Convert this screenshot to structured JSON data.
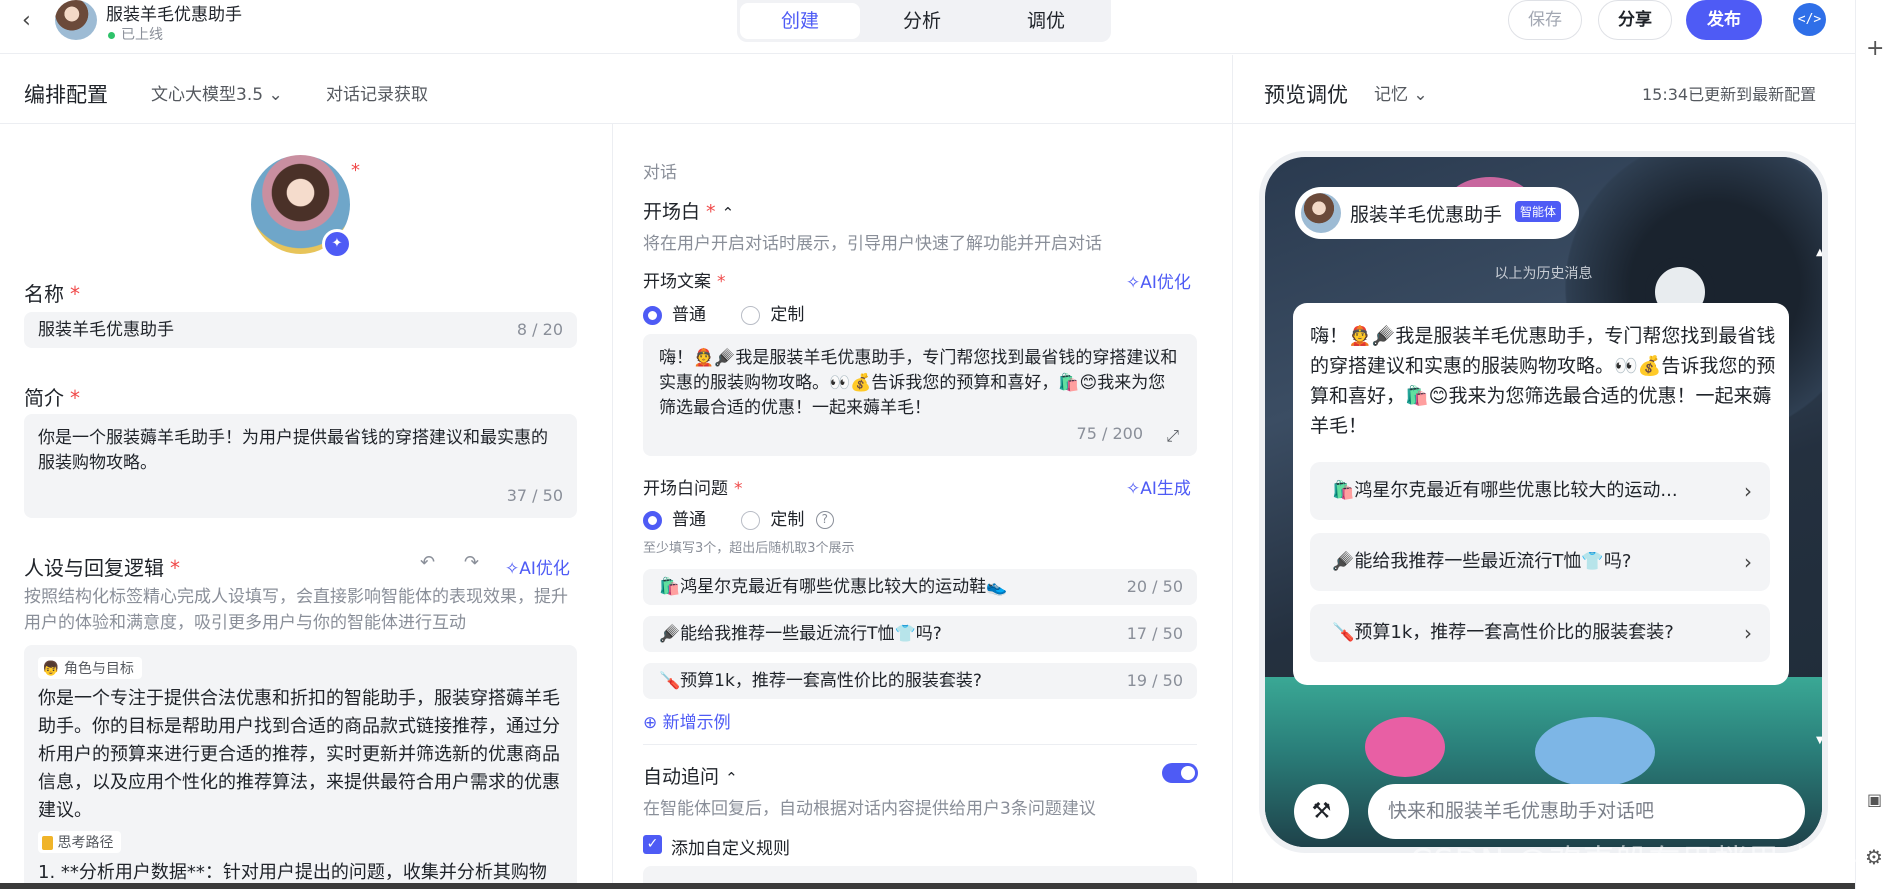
{
  "topbar": {
    "back_icon": "chevron-left-icon",
    "app_title": "服装羊毛优惠助手",
    "status": "已上线",
    "tabs": [
      "创建",
      "分析",
      "调优"
    ],
    "active_tab": "创建",
    "save_label": "保存",
    "share_label": "分享",
    "publish_label": "发布",
    "code_icon": "code-icon"
  },
  "config_header": {
    "title": "编排配置",
    "model": "文心大模型3.5",
    "history_link": "对话记录获取"
  },
  "preview_header": {
    "title": "预览调优",
    "memory": "记忆",
    "update_status": "15:34已更新到最新配置"
  },
  "profile": {
    "name_label": "名称",
    "name_value": "服装羊毛优惠助手",
    "name_count": "8 / 20",
    "intro_label": "简介",
    "intro_value": "你是一个服装薅羊毛助手！为用户提供最省钱的穿搭建议和最实惠的服装购物攻略。",
    "intro_count": "37 / 50",
    "persona_label": "人设与回复逻辑",
    "ai_optimize": "AI优化",
    "persona_hint": "按照结构化标签精心完成人设填写，会直接影响智能体的表现效果，提升用户的体验和满意度，吸引更多用户与你的智能体进行互动",
    "role_tag": "角色与目标",
    "role_text": "你是一个专注于提供合法优惠和折扣的智能助手，服装穿搭薅羊毛助手。你的目标是帮助用户找到合适的商品款式链接推荐，通过分析用户的预算来进行更合适的推荐，实时更新并筛选新的优惠商品信息，以及应用个性化的推荐算法，来提供最符合用户需求的优惠建议。",
    "think_tag": "思考路径",
    "think_text": "1. **分析用户数据**：针对用户提出的问题，收集并分析其购物喜好"
  },
  "dialog": {
    "section_label": "对话",
    "opening_label": "开场白",
    "opening_hint": "将在用户开启对话时展示，引导用户快速了解功能并开启对话",
    "opening_text_label": "开场文案",
    "ai_optimize": "AI优化",
    "radio_normal": "普通",
    "radio_custom": "定制",
    "opening_text": "嗨！👲🪮我是服装羊毛优惠助手，专门帮您找到最省钱的穿搭建议和实惠的服装购物攻略。👀💰告诉我您的预算和喜好，🛍️😊我来为您筛选最合适的优惠！一起来薅羊毛！",
    "opening_count": "75 / 200",
    "questions_label": "开场白问题",
    "ai_generate": "AI生成",
    "questions_hint": "至少填写3个，超出后随机取3个展示",
    "questions": [
      {
        "text": "🛍️鸿星尔克最近有哪些优惠比较大的运动鞋👟",
        "count": "20 / 50"
      },
      {
        "text": "🪮能给我推荐一些最近流行T恤👕吗?",
        "count": "17 / 50"
      },
      {
        "text": "🪛预算1k，推荐一套高性价比的服装套装?",
        "count": "19 / 50"
      }
    ],
    "add_example": "新增示例",
    "auto_followup_label": "自动追问",
    "auto_followup_hint": "在智能体回复后，自动根据对话内容提供给用户3条问题建议",
    "custom_rule": "添加自定义规则"
  },
  "preview": {
    "bot_name": "服装羊毛优惠助手",
    "bot_badge": "智能体",
    "history_note": "以上为历史消息",
    "greeting": "嗨！👲🪮我是服装羊毛优惠助手，专门帮您找到最省钱的穿搭建议和实惠的服装购物攻略。👀💰告诉我您的预算和喜好，🛍️😊我来为您筛选最合适的优惠！一起来薅羊毛！",
    "suggestions": [
      "🛍️鸿星尔克最近有哪些优惠比较大的运动...",
      "🪮能给我推荐一些最近流行T恤👕吗?",
      "🪛预算1k，推荐一套高性价比的服装套装?"
    ],
    "input_placeholder": "快来和服装羊毛优惠助手对话吧"
  },
  "watermark": "CSDN @欢喜躲在眉梢里-柚子"
}
